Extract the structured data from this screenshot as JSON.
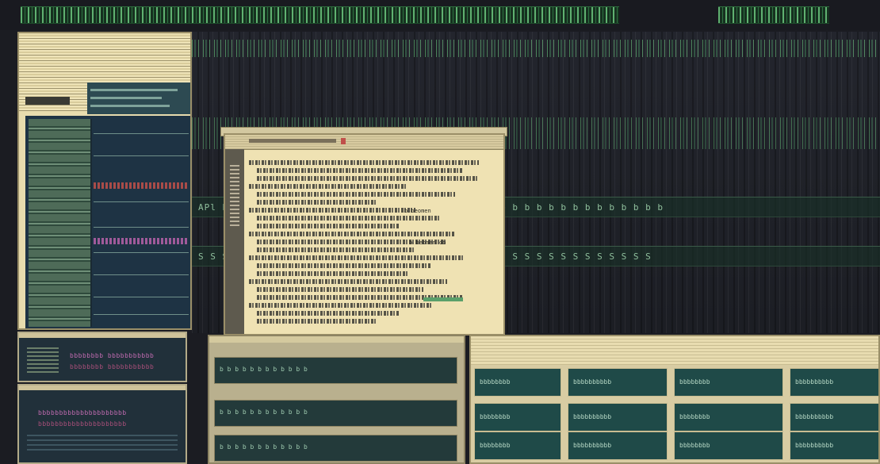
{
  "colors": {
    "background": "#1b1c22",
    "terminal_green": "#7fd38f",
    "parchment": "#efe2b3",
    "panel_dark": "#21303a",
    "accent_magenta": "#a05a9a",
    "accent_red": "#c0504a",
    "accent_teal": "#1f4a48"
  },
  "background_terminal": {
    "band_1": "APl b b b b b b b b b b b b b b b b b b b b b b b b b b b b b b b b b b b b b",
    "band_2": "S S S S S S S S S S S S S S S S S S S S S S S S S S S S S S S S S S S S S S"
  },
  "center_window": {
    "label_1": "b beomen",
    "label_2": "b beomen ob"
  },
  "lower_left_top": {
    "line_1": "bbbbbbbb bbbbbbbbbbb",
    "line_2": "bbbbbbbb bbbbbbbbbbb"
  },
  "lower_left_bottom": {
    "line_1": "bbbbbbbbbbbbbbbbbbbbb",
    "line_2": "bbbbbbbbbbbbbbbbbbbbb"
  },
  "lower_center": {
    "rows": [
      "b b b b b b b b b b b b",
      "b b b b b b b b b b b b",
      "b b b b b b b b b b b b"
    ]
  },
  "lower_right": {
    "cells": [
      "bbbbbbbb",
      "bbbbbbbbbb",
      "bbbbbbbb",
      "bbbbbbbbbb",
      "bbbbbbbb",
      "bbbbbbbbbb",
      "bbbbbbbb",
      "bbbbbbbbbb",
      "bbbbbbbb",
      "bbbbbbbbbb",
      "bbbbbbbb",
      "bbbbbbbbbb"
    ]
  }
}
